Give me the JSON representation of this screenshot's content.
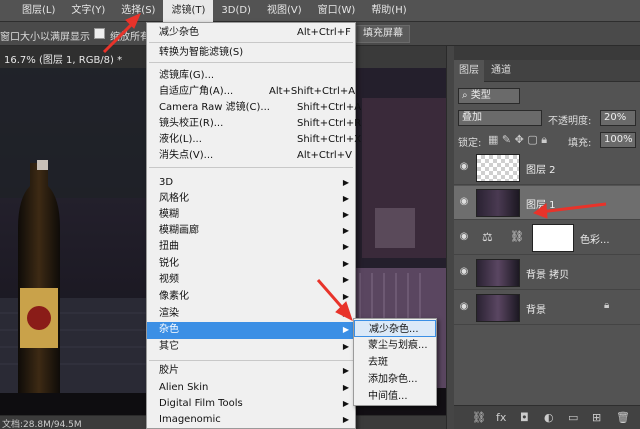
{
  "menubar": {
    "items": [
      "图层(L)",
      "文字(Y)",
      "选择(S)",
      "滤镜(T)",
      "3D(D)",
      "视图(V)",
      "窗口(W)",
      "帮助(H)"
    ]
  },
  "options_bar": {
    "fit_label": "窗口大小以满屏显示",
    "zoom_all_label": "缩放所有窗口",
    "fill_screen_label": "填充屏幕"
  },
  "document": {
    "tab_title": "16.7% (图层 1, RGB/8) *",
    "status": "文档:28.8M/94.5M"
  },
  "filter_menu": {
    "last_filter": {
      "label": "减少杂色",
      "shortcut": "Alt+Ctrl+F"
    },
    "convert_smart": "转换为智能滤镜(S)",
    "group1": [
      {
        "label": "滤镜库(G)...",
        "shortcut": ""
      },
      {
        "label": "自适应广角(A)...",
        "shortcut": "Alt+Shift+Ctrl+A"
      },
      {
        "label": "Camera Raw 滤镜(C)...",
        "shortcut": "Shift+Ctrl+A"
      },
      {
        "label": "镜头校正(R)...",
        "shortcut": "Shift+Ctrl+R"
      },
      {
        "label": "液化(L)...",
        "shortcut": "Shift+Ctrl+X"
      },
      {
        "label": "消失点(V)...",
        "shortcut": "Alt+Ctrl+V"
      }
    ],
    "group2": [
      "3D",
      "风格化",
      "模糊",
      "模糊画廊",
      "扭曲",
      "锐化",
      "视频",
      "像素化",
      "渲染",
      "杂色",
      "其它"
    ],
    "group3": [
      "胶片",
      "Alien Skin",
      "Digital Film Tools",
      "Imagenomic"
    ],
    "highlighted": "杂色"
  },
  "noise_submenu": {
    "items": [
      "减少杂色...",
      "蒙尘与划痕...",
      "去斑",
      "添加杂色...",
      "中间值..."
    ]
  },
  "layers_panel": {
    "tabs": [
      "图层",
      "通道"
    ],
    "kind_filter": "类型",
    "blend_mode": "叠加",
    "opacity_label": "不透明度:",
    "opacity_value": "20%",
    "lock_label": "锁定:",
    "fill_label": "填充:",
    "fill_value": "100%",
    "layers": [
      {
        "name": "图层 2"
      },
      {
        "name": "图层 1"
      },
      {
        "name": "色彩..."
      },
      {
        "name": "背景 拷贝"
      },
      {
        "name": "背景"
      }
    ]
  },
  "colors": {
    "menu_highlight": "#3b8fe5",
    "annotation_arrow": "#e8332a"
  }
}
